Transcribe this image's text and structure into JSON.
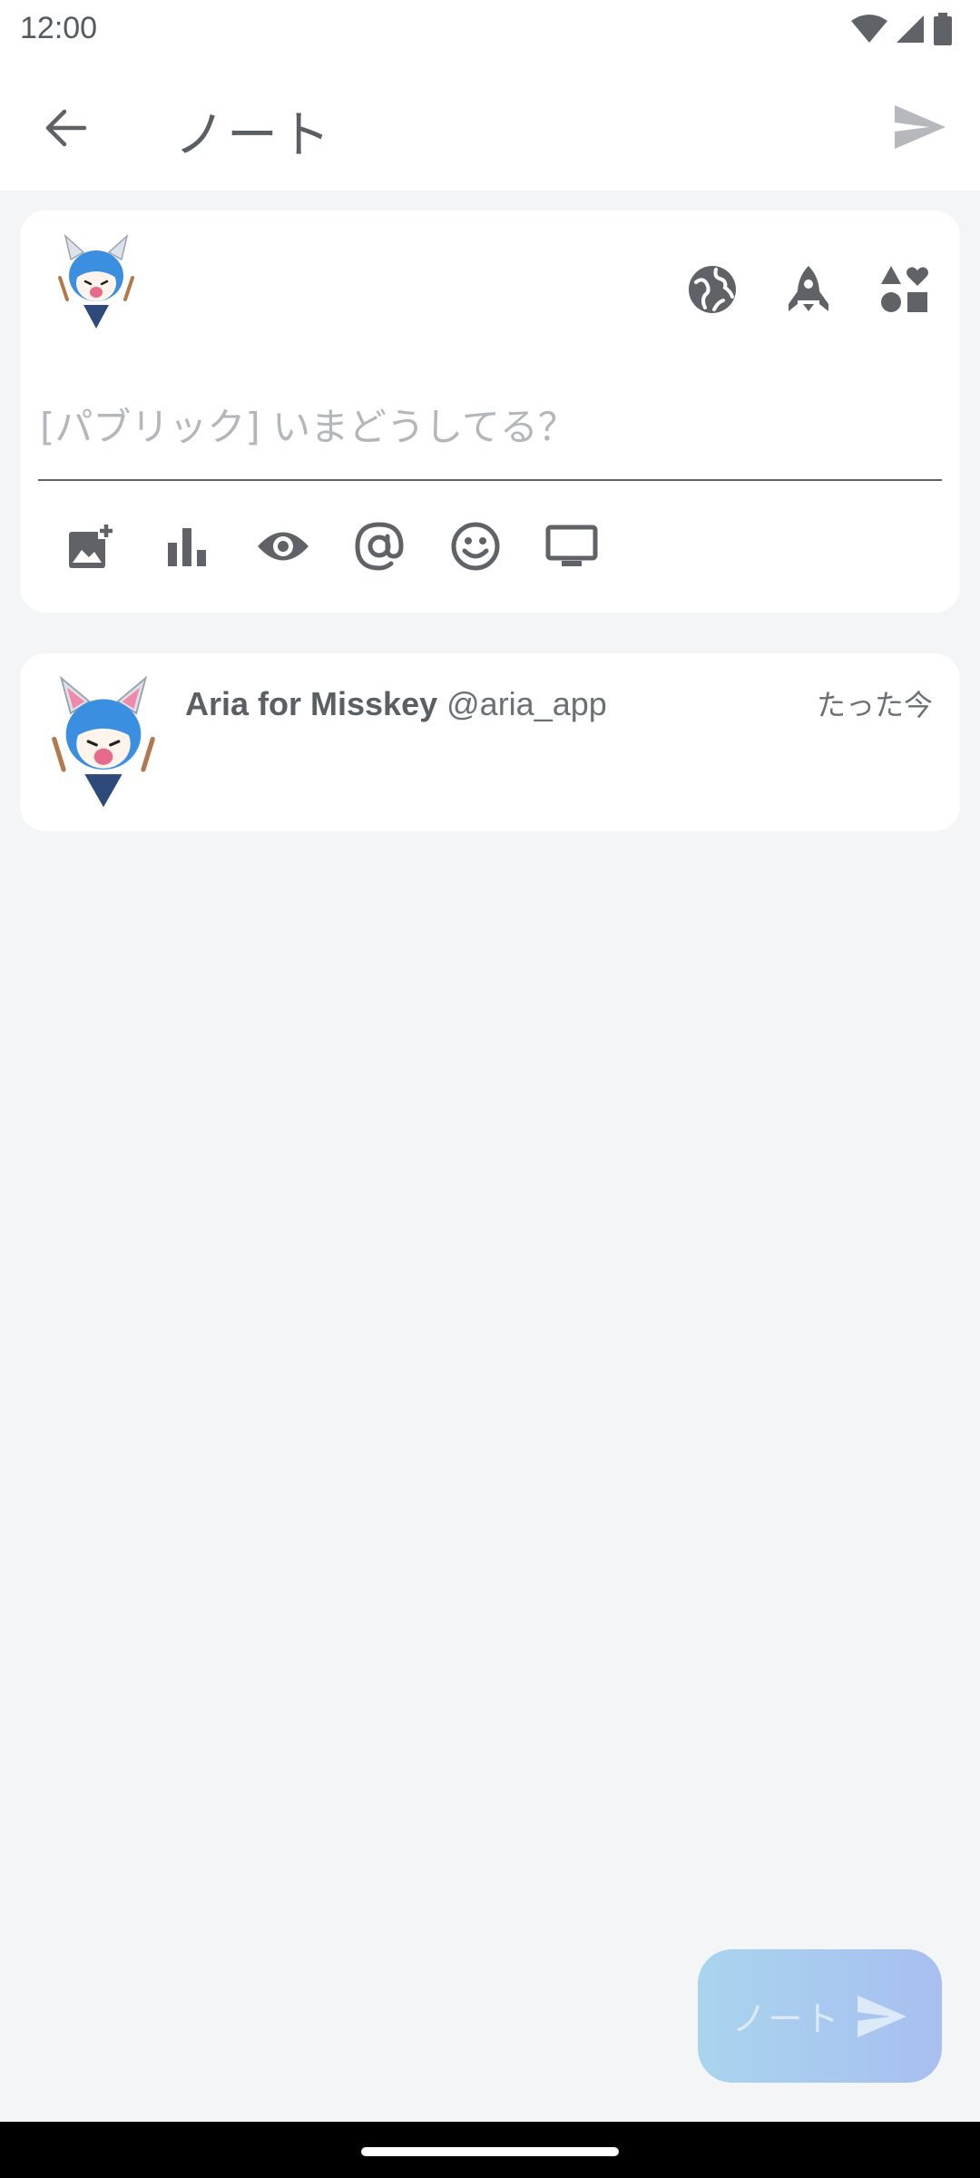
{
  "status_bar": {
    "time": "12:00",
    "icons": [
      "wifi-icon",
      "signal-icon",
      "battery-icon"
    ]
  },
  "app_bar": {
    "title": "ノート",
    "back_icon": "arrow-left-icon",
    "send_icon": "send-icon"
  },
  "composer": {
    "placeholder": "[パブリック] いまどうしてる？",
    "value": "",
    "header_actions": [
      "globe-icon",
      "rocket-icon",
      "shapes-icon"
    ],
    "tools": [
      "add-photo-icon",
      "poll-icon",
      "eye-icon",
      "at-icon",
      "emoji-icon",
      "monitor-icon"
    ]
  },
  "note": {
    "display_name": "Aria for Misskey",
    "handle": "@aria_app",
    "time": "たった今"
  },
  "fab": {
    "label": "ノート"
  },
  "colors": {
    "background": "#f4f5f7",
    "card": "#ffffff",
    "icon": "#5f6368",
    "fab_gradient_start": "#a9d4ee",
    "fab_gradient_end": "#a8bff0"
  }
}
